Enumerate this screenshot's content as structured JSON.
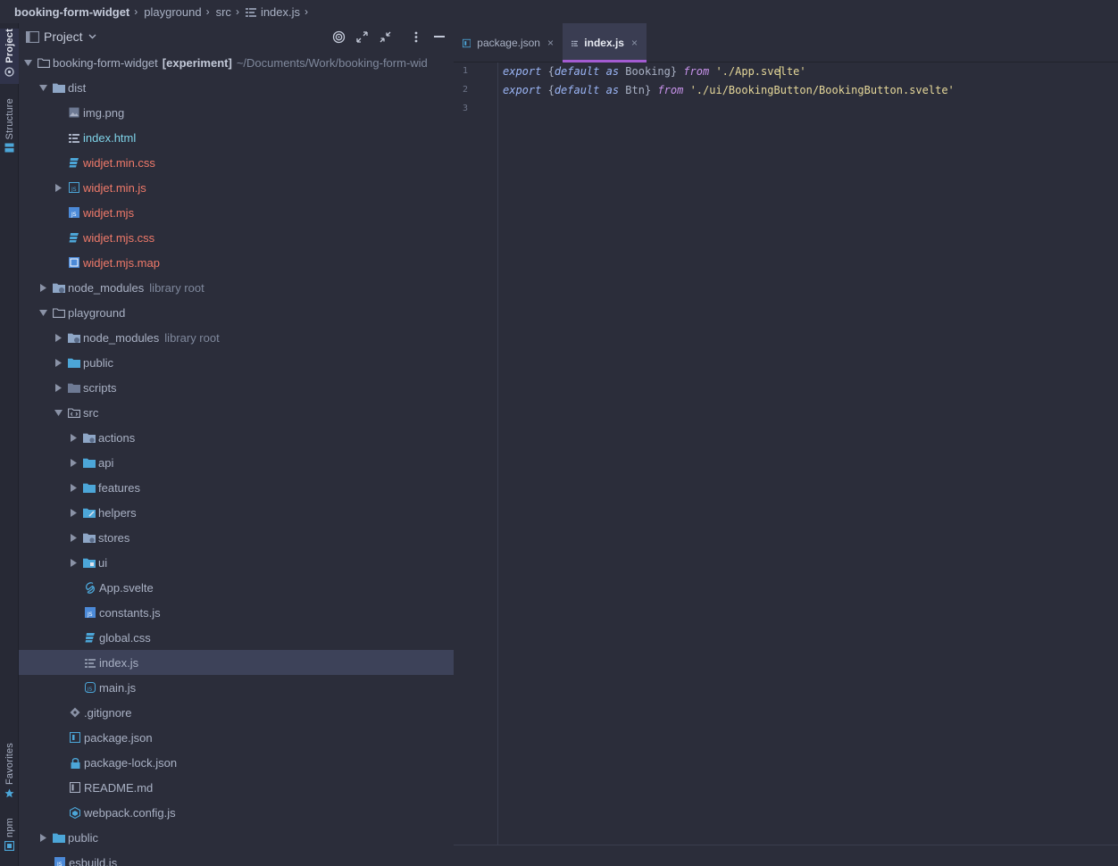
{
  "breadcrumb": {
    "items": [
      "booking-form-widget",
      "playground",
      "src",
      "index.js"
    ]
  },
  "toolstrip": {
    "project": "Project",
    "structure": "Structure",
    "favorites": "Favorites",
    "npm": "npm"
  },
  "project_panel": {
    "title": "Project"
  },
  "tree": {
    "root_name": "booking-form-widget",
    "root_tag": "[experiment]",
    "root_path": "~/Documents/Work/booking-form-wid",
    "dist": "dist",
    "img_png": "img.png",
    "index_html": "index.html",
    "widjet_min_css": "widjet.min.css",
    "widjet_min_js": "widjet.min.js",
    "widjet_mjs": "widjet.mjs",
    "widjet_mjs_css": "widjet.mjs.css",
    "widjet_mjs_map": "widjet.mjs.map",
    "node_modules": "node_modules",
    "library_root": "library root",
    "playground": "playground",
    "pg_node_modules": "node_modules",
    "pg_library_root": "library root",
    "public": "public",
    "scripts": "scripts",
    "src": "src",
    "actions": "actions",
    "api": "api",
    "features": "features",
    "helpers": "helpers",
    "stores": "stores",
    "ui": "ui",
    "app_svelte": "App.svelte",
    "constants_js": "constants.js",
    "global_css": "global.css",
    "index_js": "index.js",
    "main_js": "main.js",
    "gitignore": ".gitignore",
    "package_json": "package.json",
    "package_lock": "package-lock.json",
    "readme": "README.md",
    "webpack": "webpack.config.js",
    "root_public": "public",
    "esbuild": "esbuild.js"
  },
  "tabs": [
    {
      "label": "package.json",
      "close": "×"
    },
    {
      "label": "index.js",
      "close": "×"
    }
  ],
  "editor": {
    "line_numbers": [
      "1",
      "2",
      "3"
    ],
    "line1": {
      "export": "export",
      "open": " {",
      "default": "default",
      "as": " as ",
      "name": "Booking",
      "close": "} ",
      "from": "from",
      "str_a": " './App.sve",
      "str_b": "lte'"
    },
    "line2": {
      "export": "export",
      "open": " {",
      "default": "default",
      "as": " as ",
      "name": "Btn",
      "close": "} ",
      "from": "from",
      "str": " './ui/BookingButton/BookingButton.svelte'"
    }
  },
  "colors": {
    "background": "#2b2d3a",
    "selection": "#3d4259",
    "active_tab_underline": "#a35bd2",
    "modified_file": "#f07a6a",
    "new_file": "#7fd3e8",
    "string": "#e6d89a",
    "keyword": "#9bb5f5"
  }
}
